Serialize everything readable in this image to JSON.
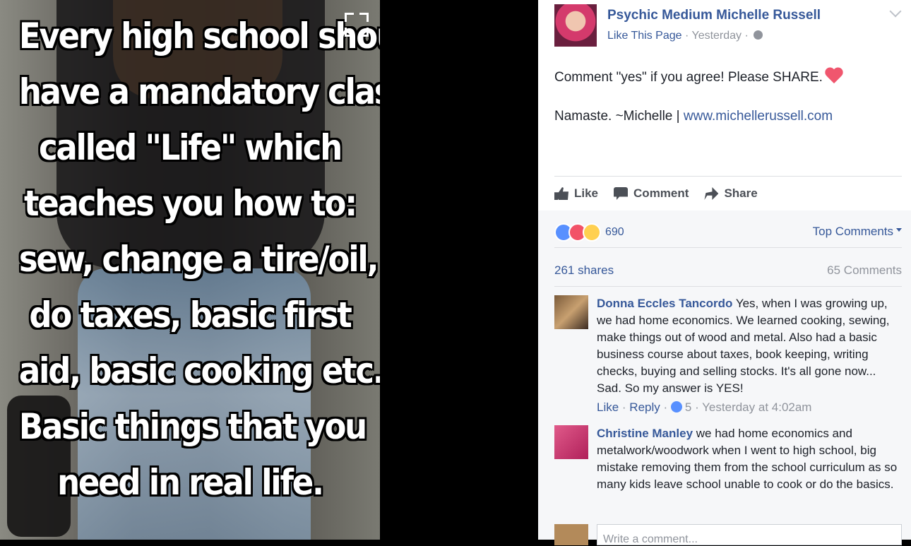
{
  "image_post": {
    "quote_lines": [
      "Every high school should",
      "have a mandatory class",
      "called \"Life\" which",
      "teaches you how to:",
      "sew, change a tire/oil,",
      "do taxes, basic first",
      "aid, basic cooking etc.",
      "Basic things that you",
      "need in real life."
    ]
  },
  "header": {
    "page_name": "Psychic Medium Michelle Russell",
    "like_page": "Like This Page",
    "sep1": " · ",
    "time": "Yesterday",
    "sep2": " · "
  },
  "post": {
    "line1": "Comment \"yes\" if you agree! Please SHARE.",
    "line2_prefix": "Namaste. ~Michelle | ",
    "link": "www.michellerussell.com"
  },
  "actions": {
    "like": "Like",
    "comment": "Comment",
    "share": "Share"
  },
  "stats": {
    "reactions_count": "690",
    "sort": "Top Comments",
    "shares": "261 shares",
    "comments": "65 Comments"
  },
  "comments": [
    {
      "name": "Donna Eccles Tancordo",
      "text": " Yes, when I was growing up, we had home economics. We learned cooking, sewing, make things out of wood and metal. Also had a basic business course about taxes, book keeping, writing checks, buying and selling stocks. It's all gone now... Sad. So my answer is YES!",
      "like": "Like",
      "reply": "Reply",
      "likes": "5",
      "time": "Yesterday at 4:02am"
    },
    {
      "name": "Christine Manley",
      "text": " we had home economics and metalwork/woodwork when I went to high school, big mistake removing them from the school curriculum as so many kids leave school unable to cook or do the basics."
    }
  ],
  "composer": {
    "placeholder": "Write a comment..."
  },
  "colors": {
    "link": "#365899",
    "text": "#1d2129",
    "muted": "#90949c",
    "heart": "#f0566e"
  }
}
